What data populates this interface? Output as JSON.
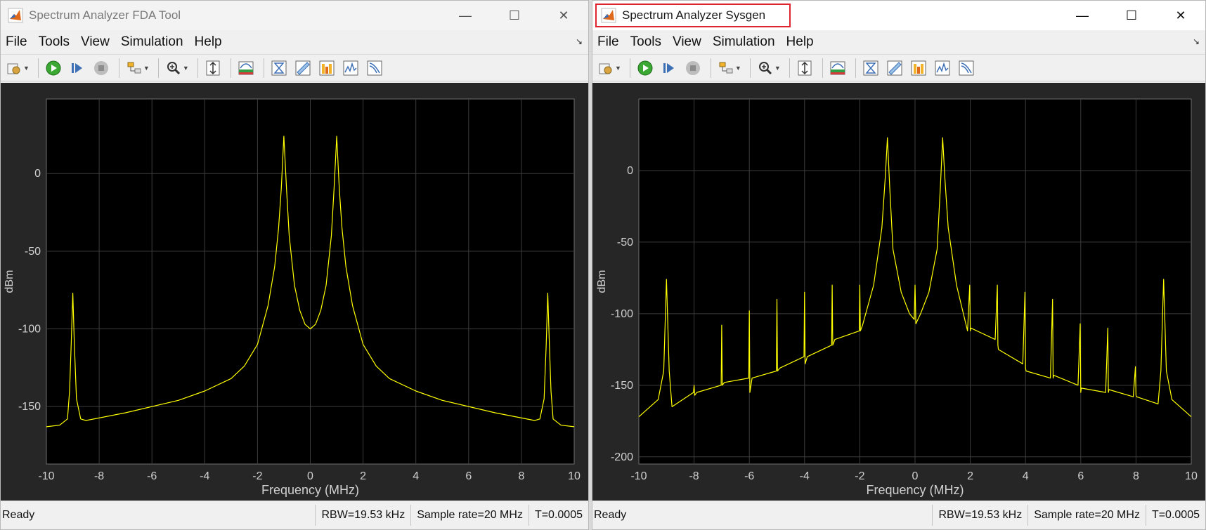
{
  "windows": [
    {
      "title": "Spectrum Analyzer FDA Tool",
      "menu": [
        "File",
        "Tools",
        "View",
        "Simulation",
        "Help"
      ],
      "status": {
        "ready": "Ready",
        "rbw": "RBW=19.53 kHz",
        "sample_rate": "Sample rate=20 MHz",
        "time": "T=0.0005"
      },
      "chart_data": {
        "type": "line",
        "xlabel": "Frequency (MHz)",
        "ylabel": "dBm",
        "xlim": [
          -10,
          10
        ],
        "ylim": [
          -187,
          48
        ],
        "xticks": [
          -10,
          -8,
          -6,
          -4,
          -2,
          0,
          2,
          4,
          6,
          8,
          10
        ],
        "yticks": [
          0,
          -50,
          -100,
          -150
        ],
        "grid": true,
        "line_color": "#ffff00",
        "series": [
          {
            "x": [
              -10,
              -9.5,
              -9.2,
              -9.12,
              -9.06,
              -9.0,
              -8.94,
              -8.86,
              -8.7,
              -8.5,
              -7,
              -5,
              -4,
              -3,
              -2.5,
              -2,
              -1.6,
              -1.35,
              -1.2,
              -1.1,
              -1.0,
              -0.9,
              -0.8,
              -0.6,
              -0.4,
              -0.2,
              0,
              0.2,
              0.4,
              0.6,
              0.8,
              0.9,
              1.0,
              1.1,
              1.2,
              1.35,
              1.6,
              2,
              2.5,
              3,
              4,
              5,
              7,
              8.5,
              8.7,
              8.86,
              8.94,
              9.0,
              9.06,
              9.12,
              9.2,
              9.5,
              10
            ],
            "y": [
              -163,
              -162,
              -158,
              -140,
              -110,
              -77,
              -110,
              -145,
              -158,
              -159,
              -154,
              -146,
              -140,
              -132,
              -124,
              -110,
              -85,
              -60,
              -35,
              -10,
              24,
              -10,
              -40,
              -72,
              -88,
              -97,
              -100,
              -97,
              -88,
              -72,
              -40,
              -10,
              24,
              -10,
              -35,
              -60,
              -85,
              -110,
              -124,
              -132,
              -140,
              -146,
              -154,
              -159,
              -158,
              -145,
              -110,
              -77,
              -110,
              -140,
              -158,
              -162,
              -163
            ]
          }
        ]
      }
    },
    {
      "title": "Spectrum Analyzer Sysgen",
      "menu": [
        "File",
        "Tools",
        "View",
        "Simulation",
        "Help"
      ],
      "status": {
        "ready": "Ready",
        "rbw": "RBW=19.53 kHz",
        "sample_rate": "Sample rate=20 MHz",
        "time": "T=0.0005"
      },
      "chart_data": {
        "type": "line",
        "xlabel": "Frequency (MHz)",
        "ylabel": "dBm",
        "xlim": [
          -10,
          10
        ],
        "ylim": [
          -205,
          50
        ],
        "xticks": [
          -10,
          -8,
          -6,
          -4,
          -2,
          0,
          2,
          4,
          6,
          8,
          10
        ],
        "yticks": [
          0,
          -50,
          -100,
          -150,
          -200
        ],
        "grid": true,
        "line_color": "#ffff00",
        "series": [
          {
            "x": [
              -10,
              -9.3,
              -9.1,
              -9.0,
              -8.9,
              -8.8,
              -8.02,
              -8.0,
              -7.98,
              -7.9,
              -7.02,
              -7.0,
              -6.98,
              -6.9,
              -6.02,
              -6.0,
              -5.98,
              -5.9,
              -5.02,
              -5.0,
              -4.98,
              -4.9,
              -4.02,
              -4.0,
              -3.98,
              -3.9,
              -3.02,
              -3.0,
              -2.98,
              -2.9,
              -2.02,
              -2.0,
              -1.98,
              -1.9,
              -1.5,
              -1.2,
              -1.08,
              -1.0,
              -0.92,
              -0.8,
              -0.5,
              -0.2,
              -0.03,
              0,
              0.03,
              0.2,
              0.5,
              0.8,
              0.92,
              1.0,
              1.08,
              1.2,
              1.5,
              1.9,
              1.98,
              2.0,
              2.02,
              2.9,
              2.98,
              3.0,
              3.02,
              3.9,
              3.98,
              4.0,
              4.02,
              4.9,
              4.98,
              5.0,
              5.02,
              5.9,
              5.98,
              6.0,
              6.02,
              6.9,
              6.98,
              7.0,
              7.02,
              7.9,
              7.98,
              8.0,
              8.02,
              8.8,
              8.9,
              9.0,
              9.1,
              9.3,
              10
            ],
            "y": [
              -172,
              -160,
              -140,
              -76,
              -140,
              -165,
              -155,
              -150,
              -157,
              -155,
              -150,
              -108,
              -150,
              -148,
              -145,
              -98,
              -155,
              -145,
              -140,
              -90,
              -140,
              -138,
              -130,
              -85,
              -135,
              -130,
              -122,
              -80,
              -122,
              -118,
              -112,
              -80,
              -112,
              -108,
              -80,
              -40,
              -5,
              23,
              -10,
              -55,
              -85,
              -100,
              -104,
              -80,
              -107,
              -100,
              -85,
              -55,
              -10,
              23,
              -5,
              -40,
              -80,
              -112,
              -80,
              -112,
              -110,
              -118,
              -80,
              -122,
              -125,
              -135,
              -85,
              -138,
              -140,
              -145,
              -90,
              -145,
              -143,
              -150,
              -107,
              -155,
              -152,
              -155,
              -110,
              -155,
              -153,
              -158,
              -137,
              -157,
              -158,
              -163,
              -140,
              -76,
              -140,
              -160,
              -172
            ]
          }
        ]
      }
    }
  ]
}
